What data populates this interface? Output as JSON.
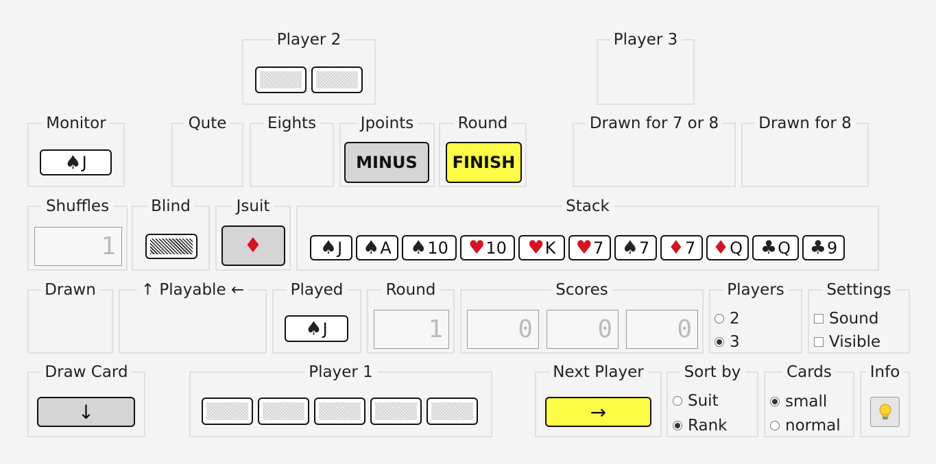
{
  "panels": {
    "player2": "Player 2",
    "player3": "Player 3",
    "monitor": "Monitor",
    "qute": "Qute",
    "eights": "Eights",
    "jpoints": "Jpoints",
    "round_top": "Round",
    "drawn78": "Drawn for 7 or 8",
    "drawn8": "Drawn for 8",
    "shuffles": "Shuffles",
    "blind": "Blind",
    "jsuit": "Jsuit",
    "stack": "Stack",
    "drawn": "Drawn",
    "playable": "↑ Playable ←",
    "played": "Played",
    "round": "Round",
    "scores": "Scores",
    "players": "Players",
    "settings": "Settings",
    "draw_card": "Draw Card",
    "player1": "Player 1",
    "next_player": "Next Player",
    "sort_by": "Sort by",
    "cards": "Cards",
    "info": "Info"
  },
  "buttons": {
    "minus": "MINUS",
    "finish": "FINISH",
    "draw_arrow": "↓",
    "next_arrow": "→"
  },
  "monitor_card": {
    "suit": "♠",
    "rank": "J",
    "color": "#222222"
  },
  "jsuit_card": {
    "suit": "♦",
    "color": "#d41324"
  },
  "played_card": {
    "suit": "♠",
    "rank": "J",
    "color": "#222222"
  },
  "stack_cards": [
    {
      "suit": "♠",
      "rank": "J",
      "color": "#222222"
    },
    {
      "suit": "♠",
      "rank": "A",
      "color": "#222222"
    },
    {
      "suit": "♠",
      "rank": "10",
      "color": "#222222"
    },
    {
      "suit": "♥",
      "rank": "10",
      "color": "#d41324"
    },
    {
      "suit": "♥",
      "rank": "K",
      "color": "#d41324"
    },
    {
      "suit": "♥",
      "rank": "7",
      "color": "#d41324"
    },
    {
      "suit": "♠",
      "rank": "7",
      "color": "#222222"
    },
    {
      "suit": "♦",
      "rank": "7",
      "color": "#d41324"
    },
    {
      "suit": "♦",
      "rank": "Q",
      "color": "#d41324"
    },
    {
      "suit": "♣",
      "rank": "Q",
      "color": "#222222"
    },
    {
      "suit": "♣",
      "rank": "9",
      "color": "#222222"
    }
  ],
  "player2_hand_count": 2,
  "player1_hand_count": 5,
  "displays": {
    "shuffles": "1",
    "round": "1",
    "scores": [
      "0",
      "0",
      "0"
    ]
  },
  "players_options": [
    {
      "label": "2",
      "selected": false
    },
    {
      "label": "3",
      "selected": true
    }
  ],
  "settings_options": [
    {
      "label": "Sound",
      "checked": false
    },
    {
      "label": "Visible",
      "checked": false
    }
  ],
  "sort_options": [
    {
      "label": "Suit",
      "selected": false
    },
    {
      "label": "Rank",
      "selected": true
    }
  ],
  "cards_options": [
    {
      "label": "small",
      "selected": true
    },
    {
      "label": "normal",
      "selected": false
    }
  ],
  "info_icon": "lightbulb-icon",
  "colors": {
    "background": "#f4f4f4",
    "button_gray": "#d5d5d5",
    "button_yellow": "#fcfc47",
    "red_suit": "#d41324",
    "black_suit": "#222222"
  }
}
